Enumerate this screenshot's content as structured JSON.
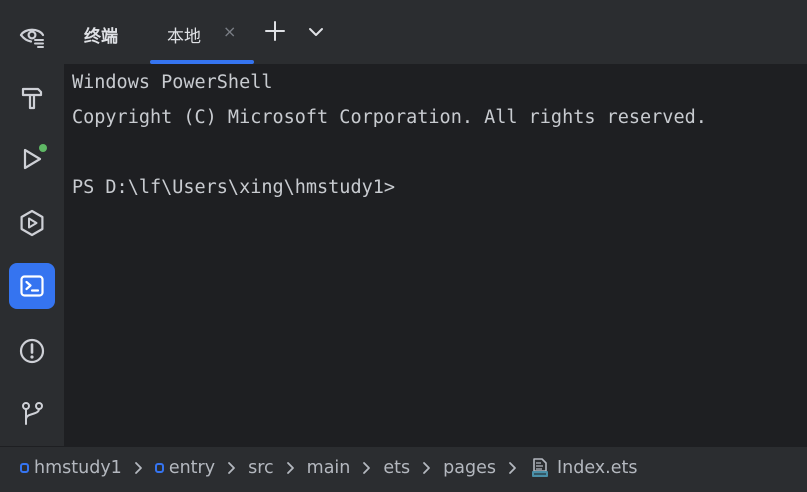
{
  "colors": {
    "accent": "#3574f0",
    "run_indicator": "#5fb865",
    "terminal_bg": "#1e1f22",
    "chrome_bg": "#2b2d30"
  },
  "toolstrip": {
    "items": [
      {
        "icon": "eye-icon",
        "active": false
      },
      {
        "icon": "hammer-icon",
        "active": false
      },
      {
        "icon": "run-icon",
        "active": false
      },
      {
        "icon": "preview-icon",
        "active": false
      },
      {
        "icon": "terminal-icon",
        "active": true
      },
      {
        "icon": "problems-icon",
        "active": false
      },
      {
        "icon": "git-branch-icon",
        "active": false
      }
    ]
  },
  "tabbar": {
    "title": "终端",
    "tabs": [
      {
        "label": "本地",
        "close": "×"
      }
    ],
    "add_icon": "plus-icon",
    "more_icon": "chevron-down-icon"
  },
  "terminal": {
    "lines": [
      "Windows PowerShell",
      "Copyright (C) Microsoft Corporation. All rights reserved.",
      "",
      "PS D:\\lf\\Users\\xing\\hmstudy1>"
    ]
  },
  "breadcrumb": {
    "items": [
      {
        "label": "hmstudy1",
        "icon": "module-icon"
      },
      {
        "label": "entry",
        "icon": "module-icon"
      },
      {
        "label": "src",
        "icon": ""
      },
      {
        "label": "main",
        "icon": ""
      },
      {
        "label": "ets",
        "icon": ""
      },
      {
        "label": "pages",
        "icon": ""
      },
      {
        "label": "Index.ets",
        "icon": "ets-file-icon"
      }
    ]
  }
}
